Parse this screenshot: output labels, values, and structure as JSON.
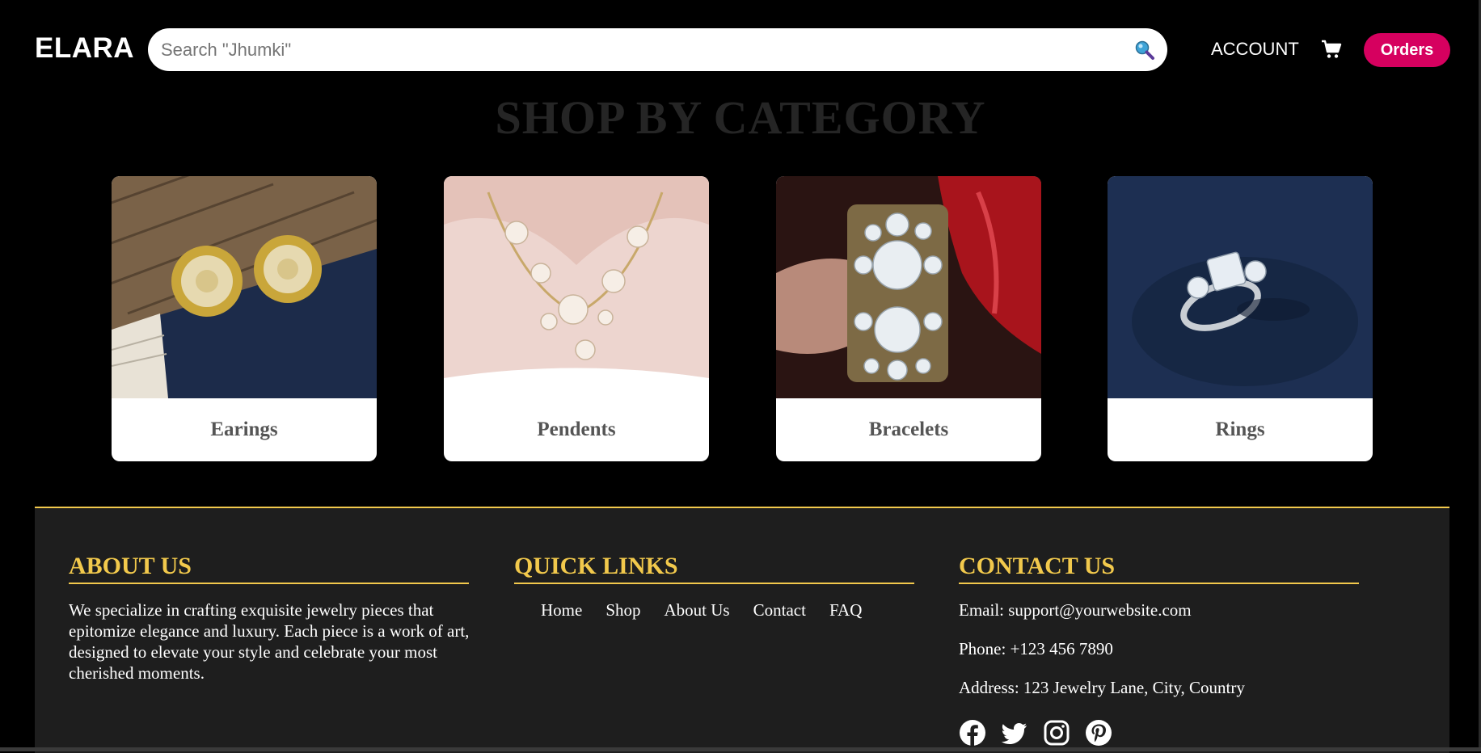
{
  "header": {
    "logo": "ELARA",
    "search_placeholder": "Search \"Jhumki\"",
    "account_label": "ACCOUNT",
    "orders_label": "Orders"
  },
  "categories_title": "SHOP BY CATEGORY",
  "categories": [
    {
      "label": "Earings"
    },
    {
      "label": "Pendents"
    },
    {
      "label": "Bracelets"
    },
    {
      "label": "Rings"
    }
  ],
  "footer": {
    "about": {
      "heading": "ABOUT US",
      "text": "We specialize in crafting exquisite jewelry pieces that epitomize elegance and luxury. Each piece is a work of art, designed to elevate your style and celebrate your most cherished moments."
    },
    "quick_links": {
      "heading": "QUICK LINKS",
      "items": [
        "Home",
        "Shop",
        "About Us",
        "Contact",
        "FAQ"
      ]
    },
    "contact": {
      "heading": "CONTACT US",
      "email": "Email: support@yourwebsite.com",
      "phone": "Phone: +123 456 7890",
      "address": "Address: 123 Jewelry Lane, City, Country"
    },
    "social_icons": [
      "facebook-icon",
      "twitter-icon",
      "instagram-icon",
      "pinterest-icon"
    ]
  },
  "colors": {
    "accent_gold": "#f2c94c",
    "orders_pink": "#d6005f",
    "footer_bg": "#1e1e1e",
    "page_bg": "#000000"
  }
}
